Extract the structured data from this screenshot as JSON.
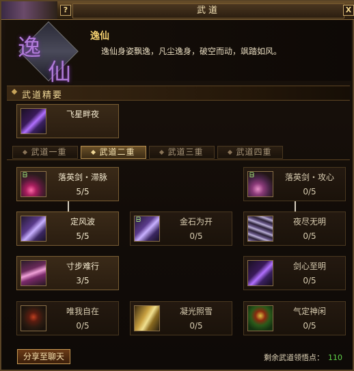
{
  "window": {
    "title": "武道",
    "help_label": "?",
    "close_label": "X"
  },
  "school": {
    "emblem_char_1": "逸",
    "emblem_char_2": "仙",
    "name": "逸仙",
    "description": "逸仙身姿飘逸，凡尘逸身，破空而动，飒踏如风。"
  },
  "essence": {
    "section_title": "武道精要",
    "skill": {
      "name": "飞星畔夜",
      "icon": "purple-dash-icon"
    }
  },
  "tabs": [
    {
      "label": "武道一重",
      "active": false
    },
    {
      "label": "武道二重",
      "active": true
    },
    {
      "label": "武道三重",
      "active": false
    },
    {
      "label": "武道四重",
      "active": false
    }
  ],
  "skills": {
    "r1c1": {
      "name": "落英剑・滞脉",
      "count": "5/5",
      "icon": "sword-icon"
    },
    "r1c3": {
      "name": "落英剑・攻心",
      "count": "0/5",
      "icon": "sword-icon"
    },
    "r2c1": {
      "name": "定风波",
      "count": "5/5",
      "icon": "violet-icon"
    },
    "r2c2": {
      "name": "金石为开",
      "count": "0/5",
      "icon": "violet-icon"
    },
    "r2c3": {
      "name": "夜尽无明",
      "count": "0/5",
      "icon": "night-icon"
    },
    "r3c1": {
      "name": "寸步难行",
      "count": "3/5",
      "icon": "wing-icon"
    },
    "r3c3": {
      "name": "剑心至明",
      "count": "0/5",
      "icon": "violet-icon"
    },
    "r4c1": {
      "name": "唯我自在",
      "count": "0/5",
      "icon": "figure-icon"
    },
    "r4c2": {
      "name": "凝光照雪",
      "count": "0/5",
      "icon": "gold-icon"
    },
    "r4c3": {
      "name": "气定神闲",
      "count": "0/5",
      "icon": "green-icon"
    }
  },
  "footer": {
    "share_label": "分享至聊天",
    "points_label": "剩余武道领悟点：",
    "points_value": "110"
  },
  "colors": {
    "accent_gold": "#f4d070",
    "points_green": "#62d44a",
    "border_bronze": "#7a5e34"
  }
}
